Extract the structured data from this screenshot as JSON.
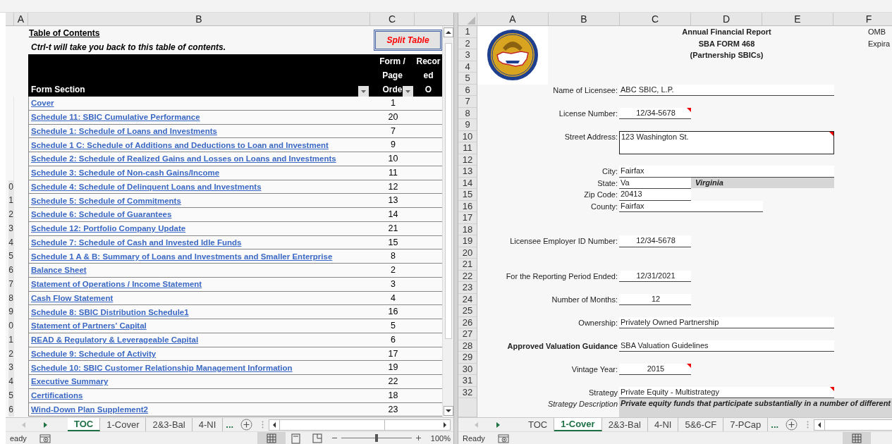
{
  "left_pane": {
    "column_headers": [
      "A",
      "B",
      "C"
    ],
    "title": "Table of Contents",
    "note": "Ctrl-t will take you back to this table of contents.",
    "split_button": "Split Table",
    "table": {
      "columns": [
        "Form Section",
        "Form /\nPage\nOrde",
        "Recor\ned\nO"
      ],
      "rows": [
        {
          "section": "Cover",
          "page": "1"
        },
        {
          "section": "Schedule 11:  SBIC Cumulative Performance",
          "page": "20"
        },
        {
          "section": "Schedule 1:  Schedule of Loans and Investments",
          "page": "7"
        },
        {
          "section": "Schedule 1 C:  Schedule of Additions and Deductions to Loan and Investment",
          "page": "9"
        },
        {
          "section": "Schedule 2:  Schedule of Realized Gains and Losses on Loans and Investments",
          "page": "10"
        },
        {
          "section": "Schedule 3:  Schedule of Non-cash Gains/Income",
          "page": "11"
        },
        {
          "section": "Schedule 4:  Schedule of Delinquent Loans and Investments",
          "page": "12",
          "row_digit": "0"
        },
        {
          "section": "Schedule 5:  Schedule of Commitments",
          "page": "13",
          "row_digit": "1"
        },
        {
          "section": "Schedule 6:  Schedule of Guarantees",
          "page": "14",
          "row_digit": "2"
        },
        {
          "section": "Schedule 12:  Portfolio Company Update",
          "page": "21",
          "row_digit": "3"
        },
        {
          "section": "Schedule 7:  Schedule of Cash and Invested Idle Funds",
          "page": "15",
          "row_digit": "4"
        },
        {
          "section": "Schedule 1 A & B: Summary of Loans and Investments and Smaller Enterprise",
          "page": "8",
          "row_digit": "5"
        },
        {
          "section": "Balance Sheet",
          "page": "2",
          "row_digit": "6"
        },
        {
          "section": "Statement of Operations / Income Statement",
          "page": "3",
          "row_digit": "7"
        },
        {
          "section": "Cash Flow Statement",
          "page": "4",
          "row_digit": "8"
        },
        {
          "section": "Schedule 8:  SBIC Distribution Schedule1",
          "page": "16",
          "row_digit": "9"
        },
        {
          "section": "Statement of Partners' Capital",
          "page": "5",
          "row_digit": "0"
        },
        {
          "section": "READ & Regulatory & Leverageable Capital",
          "page": "6",
          "row_digit": "1"
        },
        {
          "section": "Schedule 9:  Schedule of Activity",
          "page": "17",
          "row_digit": "2"
        },
        {
          "section": "Schedule 10:  SBIC Customer Relationship Management Information",
          "page": "19",
          "row_digit": "3"
        },
        {
          "section": "Executive Summary",
          "page": "22",
          "row_digit": "4"
        },
        {
          "section": "Certifications",
          "page": "18",
          "row_digit": "5"
        },
        {
          "section": "Wind-Down Plan Supplement2",
          "page": "23",
          "row_digit": "6"
        }
      ]
    },
    "sheet_tabs": [
      {
        "label": "TOC",
        "selected": true
      },
      {
        "label": "1-Cover",
        "selected": false
      },
      {
        "label": "2&3-Bal",
        "selected": false
      },
      {
        "label": "4-NI",
        "selected": false
      }
    ],
    "more_tabs": "...",
    "status_bar": {
      "text": "eady",
      "zoom": {
        "level": 0.5,
        "reading": "100%"
      }
    }
  },
  "right_pane": {
    "column_headers": [
      "A",
      "B",
      "C",
      "D",
      "E",
      "F"
    ],
    "rows": [
      {
        "number": "1",
        "title": "Annual Financial Report",
        "side": "OMB"
      },
      {
        "number": "2",
        "title": "SBA FORM 468",
        "side": "Expira"
      },
      {
        "number": "3",
        "title": "(Partnership SBICs)"
      },
      {
        "number": "4"
      },
      {
        "number": "5"
      },
      {
        "number": "6",
        "label": "Name of Licensee:",
        "value": "ABC SBIC, L.P.",
        "kind": "wide"
      },
      {
        "number": "7"
      },
      {
        "number": "8",
        "label": "License Number:",
        "value": "12/34-5678",
        "kind": "short",
        "comment": true
      },
      {
        "number": "9"
      },
      {
        "number": "10",
        "label": "Street Address:",
        "value": "123 Washington St.",
        "kind": "box",
        "comment": true
      },
      {
        "number": "11"
      },
      {
        "number": "12"
      },
      {
        "number": "13",
        "label": "City:",
        "value": "Fairfax",
        "kind": "wide"
      },
      {
        "number": "14",
        "label": "State:",
        "value": "Va",
        "kind": "left",
        "extra": "Virginia"
      },
      {
        "number": "15",
        "label": "Zip Code:",
        "value": "20413",
        "kind": "left"
      },
      {
        "number": "16",
        "label": "County:",
        "value": "Fairfax",
        "kind": "medium"
      },
      {
        "number": "17"
      },
      {
        "number": "18"
      },
      {
        "number": "19",
        "label": "Licensee Employer ID Number:",
        "value": "12/34-5678",
        "kind": "short"
      },
      {
        "number": "20"
      },
      {
        "number": "21"
      },
      {
        "number": "22",
        "label": "For the Reporting Period Ended:",
        "value": "12/31/2021",
        "kind": "short"
      },
      {
        "number": "23"
      },
      {
        "number": "24",
        "label": "Number of Months:",
        "value": "12",
        "kind": "short"
      },
      {
        "number": "25"
      },
      {
        "number": "26",
        "label": "Ownership:",
        "value": "Privately Owned Partnership",
        "kind": "wide"
      },
      {
        "number": "27"
      },
      {
        "number": "28",
        "label": "Approved Valuation Guidance",
        "label_bold": true,
        "value": "SBA Valuation Guidelines",
        "kind": "wide"
      },
      {
        "number": "29"
      },
      {
        "number": "30",
        "label": "Vintage Year:",
        "value": "2015",
        "kind": "short",
        "comment": true
      },
      {
        "number": "31"
      },
      {
        "number": "32",
        "label": "Strategy",
        "value": "Private Equity - Multistrategy",
        "kind": "wide",
        "comment": true
      },
      {
        "label": "Strategy Description",
        "label_italic": true,
        "value": "Private equity funds that participate substantially in a number of different",
        "kind": "description"
      }
    ],
    "sheet_tabs": [
      {
        "label": "TOC",
        "selected": false
      },
      {
        "label": "1-Cover",
        "selected": true
      },
      {
        "label": "2&3-Bal",
        "selected": false
      },
      {
        "label": "4-NI",
        "selected": false
      },
      {
        "label": "5&6-CF",
        "selected": false
      },
      {
        "label": "7-PCap",
        "selected": false
      }
    ],
    "more_tabs": "...",
    "status_bar": {
      "text": "Ready"
    }
  }
}
